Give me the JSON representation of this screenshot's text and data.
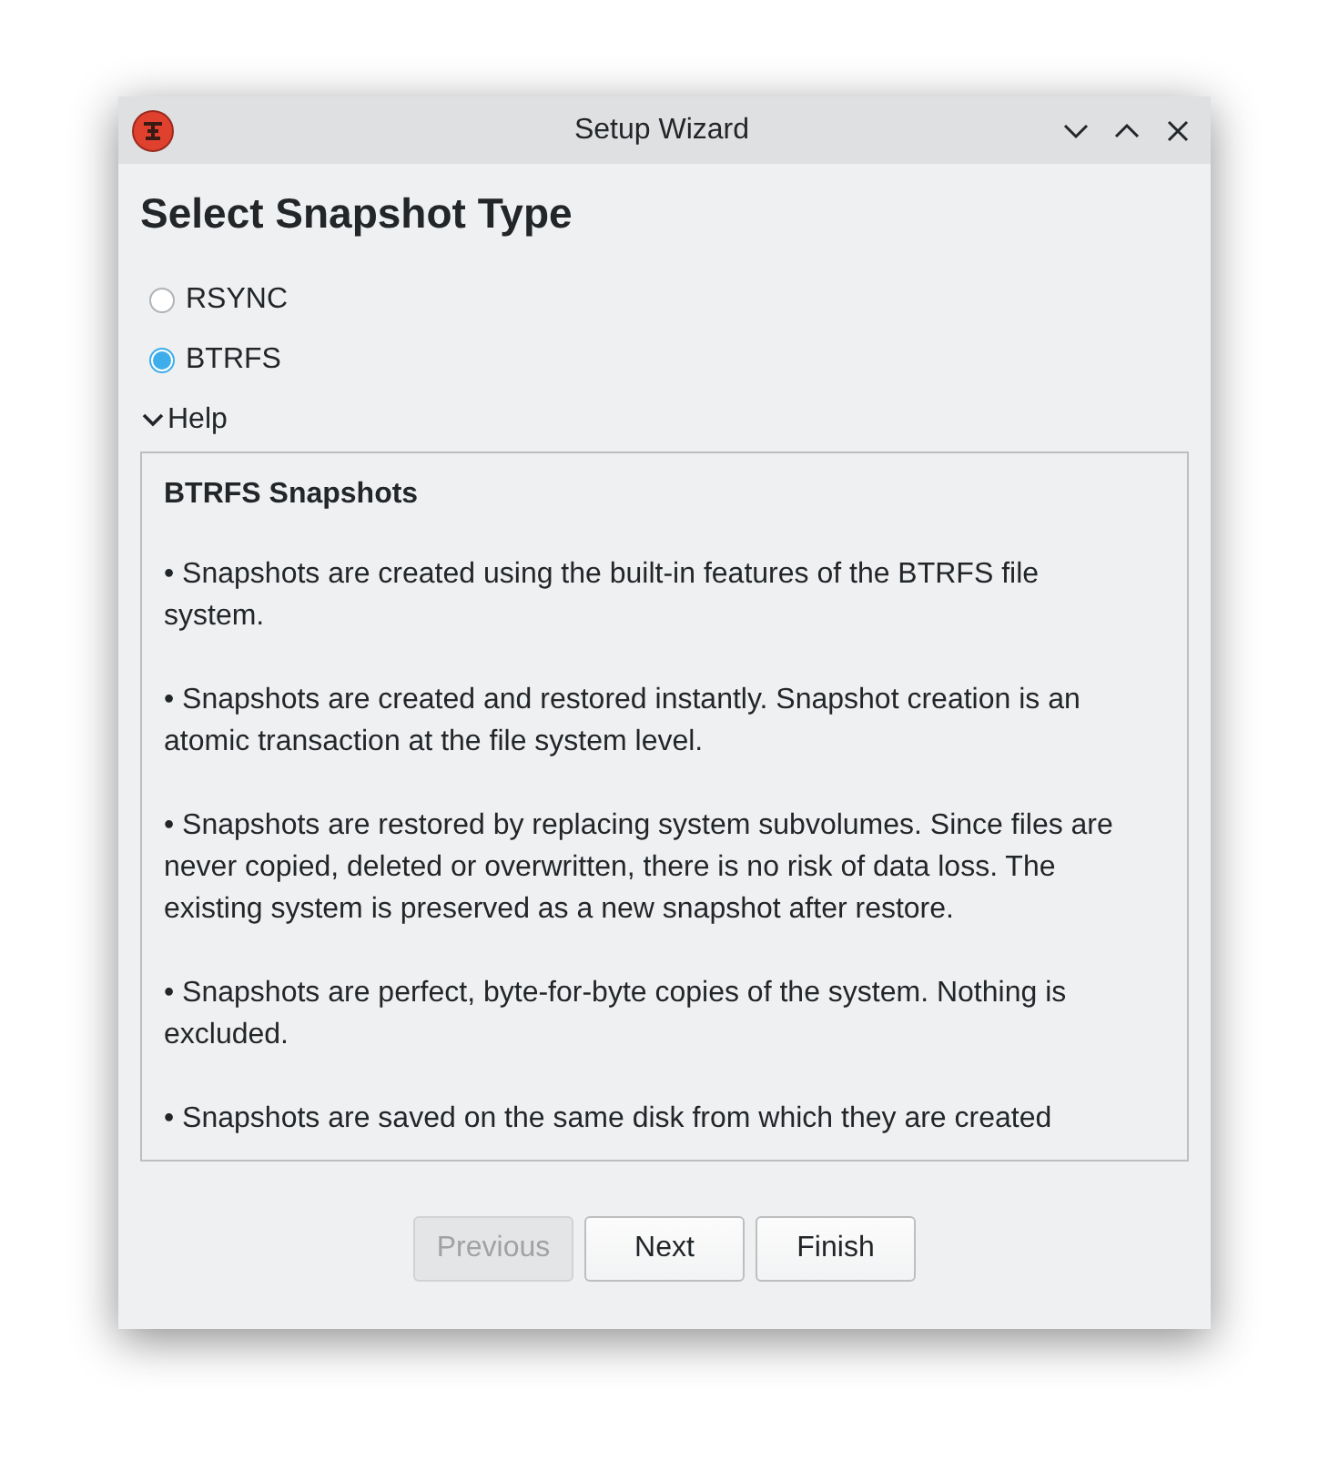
{
  "window": {
    "title": "Setup Wizard"
  },
  "heading": "Select Snapshot Type",
  "options": [
    {
      "label": "RSYNC",
      "selected": false
    },
    {
      "label": "BTRFS",
      "selected": true
    }
  ],
  "help": {
    "label": "Help",
    "expanded": true,
    "title": "BTRFS Snapshots",
    "paragraphs": [
      "• Snapshots are created using the built-in features of the BTRFS file system.",
      "• Snapshots are created and restored instantly. Snapshot creation is an atomic transaction at the file system level.",
      "• Snapshots are restored by replacing system subvolumes. Since files are never copied, deleted or overwritten, there is no risk of data loss. The existing system is preserved as a new snapshot after restore.",
      "• Snapshots are perfect, byte-for-byte copies of the system. Nothing is excluded.",
      "• Snapshots are saved on the same disk from which they are created"
    ]
  },
  "buttons": [
    {
      "label": "Previous",
      "disabled": true
    },
    {
      "label": "Next",
      "disabled": false
    },
    {
      "label": "Finish",
      "disabled": false
    }
  ]
}
